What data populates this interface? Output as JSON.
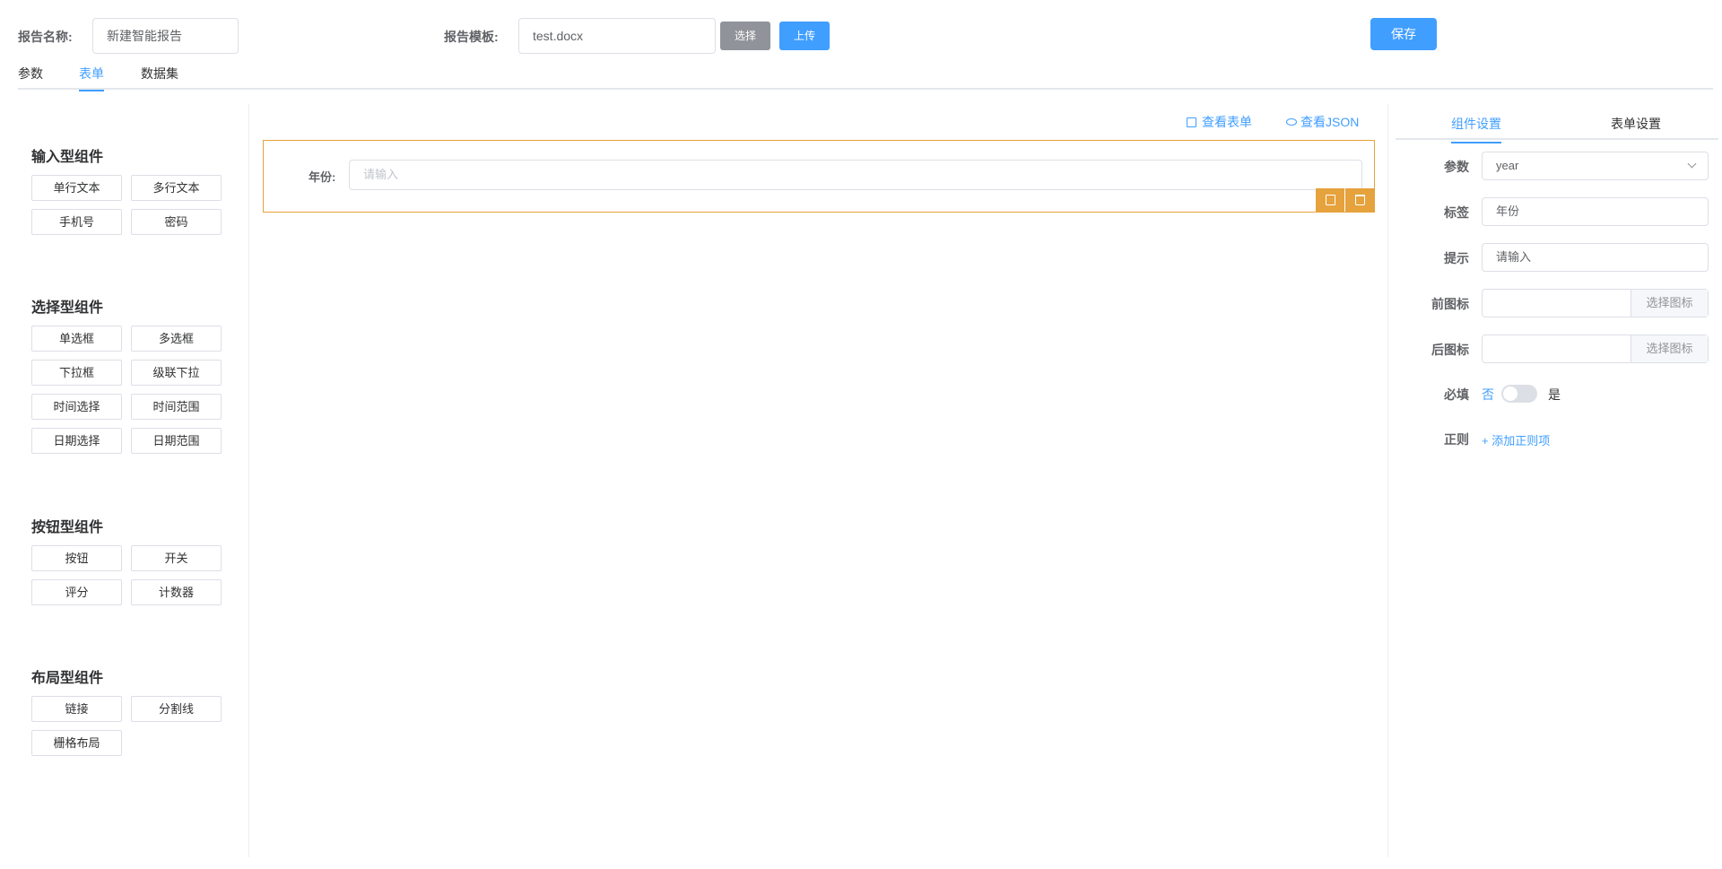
{
  "header": {
    "report_name_label": "报告名称:",
    "report_name_value": "新建智能报告",
    "template_label": "报告模板:",
    "template_value": "test.docx",
    "select_btn": "选择",
    "upload_btn": "上传",
    "save_btn": "保存"
  },
  "tabs": [
    "参数",
    "表单",
    "数据集"
  ],
  "left": {
    "groups": [
      {
        "title": "输入型组件",
        "items": [
          "单行文本",
          "多行文本",
          "手机号",
          "密码"
        ]
      },
      {
        "title": "选择型组件",
        "items": [
          "单选框",
          "多选框",
          "下拉框",
          "级联下拉",
          "时间选择",
          "时间范围",
          "日期选择",
          "日期范围"
        ]
      },
      {
        "title": "按钮型组件",
        "items": [
          "按钮",
          "开关",
          "评分",
          "计数器"
        ]
      },
      {
        "title": "布局型组件",
        "items": [
          "链接",
          "分割线",
          "栅格布局"
        ]
      }
    ]
  },
  "center": {
    "view_form": "查看表单",
    "view_json": "查看JSON",
    "field_label": "年份:",
    "field_placeholder": "请输入"
  },
  "right": {
    "tabs": [
      "组件设置",
      "表单设置"
    ],
    "param_label": "参数",
    "param_value": "year",
    "tag_label": "标签",
    "tag_value": "年份",
    "hint_label": "提示",
    "hint_value": "请输入",
    "prefix_label": "前图标",
    "suffix_label": "后图标",
    "select_icon": "选择图标",
    "required_label": "必填",
    "required_no": "否",
    "required_yes": "是",
    "required_value": false,
    "regex_label": "正则",
    "add_regex": "+ 添加正则项"
  },
  "colors": {
    "primary": "#409eff",
    "warning": "#e6a23c",
    "gray": "#909399"
  }
}
